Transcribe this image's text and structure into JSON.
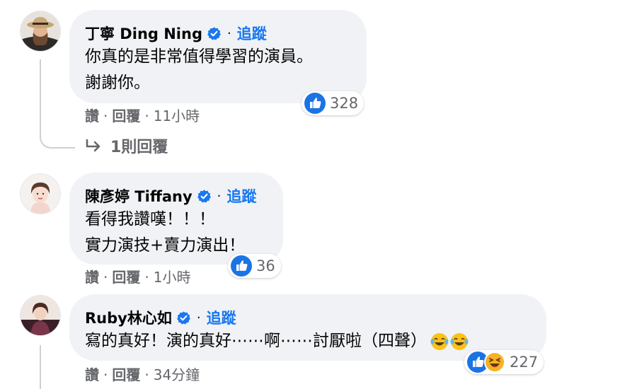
{
  "comments": [
    {
      "author": "丁寧 Ding Ning",
      "follow": "追蹤",
      "lines": [
        "你真的是非常值得學習的演員。",
        "謝謝你。"
      ],
      "reaction_count": "328",
      "actions": {
        "like": "讚",
        "reply": "回覆",
        "time": "11小時"
      },
      "avatar": "avatar-woman-with-hat"
    },
    {
      "author": "陳彥婷 Tiffany",
      "follow": "追蹤",
      "lines": [
        "看得我讚嘆！！！",
        "實力演技+賣力演出！"
      ],
      "reaction_count": "36",
      "actions": {
        "like": "讚",
        "reply": "回覆",
        "time": "1小時"
      },
      "avatar": "avatar-woman-portrait"
    },
    {
      "author": "Ruby林心如",
      "follow": "追蹤",
      "lines": [
        "寫的真好！演的真好⋯⋯啊⋯⋯討厭啦（四聲）"
      ],
      "reaction_count": "227",
      "actions": {
        "like": "讚",
        "reply": "回覆",
        "time": "34分鐘"
      },
      "avatar": "avatar-ruby"
    }
  ],
  "replies_link": "1則回覆",
  "separator": "·",
  "icons": {
    "verified": "verified-badge-icon",
    "like": "like-reaction-icon",
    "haha": "haha-reaction-icon",
    "laugh_emoji": "tears-of-joy-emoji",
    "reply_arrow": "reply-arrow-icon"
  },
  "colors": {
    "bubble": "#f0f2f5",
    "link": "#1877f2",
    "secondary_text": "#65676b",
    "primary_text": "#050505"
  }
}
